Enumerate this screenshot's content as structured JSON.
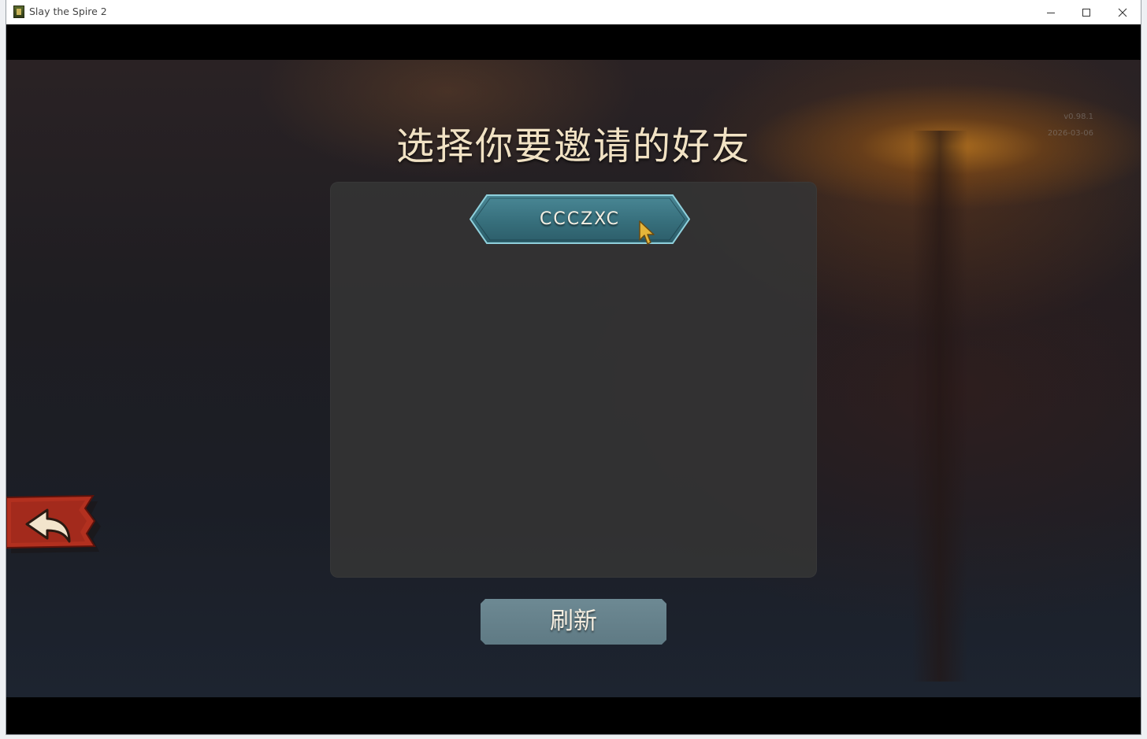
{
  "window": {
    "title": "Slay the Spire 2",
    "icons": {
      "app": "app-icon",
      "minimize": "minimize-icon",
      "maximize": "maximize-icon",
      "close": "close-icon"
    }
  },
  "game": {
    "version_line1": "v0.98.1",
    "version_line2": "2026-03-06",
    "title": "选择你要邀请的好友",
    "friends": [
      {
        "name": "CCCZXC"
      }
    ],
    "refresh_label": "刷新",
    "back_icon": "back-arrow-icon"
  },
  "colors": {
    "title_text": "#f1e2c4",
    "friend_button_fill": "#3e7a88",
    "friend_button_border": "#7fc4d2",
    "refresh_button": "#6d8993",
    "back_banner": "#b2301f",
    "panel": "#343434"
  }
}
